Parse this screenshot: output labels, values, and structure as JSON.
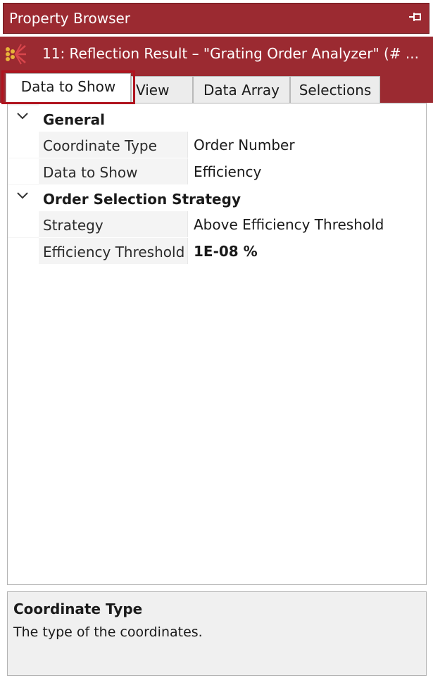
{
  "window": {
    "title": "Property Browser",
    "pin_icon": "pin-icon"
  },
  "context": {
    "icon": "grating-analyzer-icon",
    "text": "11: Reflection Result – \"Grating Order Analyzer\" (# ..."
  },
  "tabs": [
    {
      "label": "Data to Show",
      "active": true
    },
    {
      "label": "View",
      "active": false
    },
    {
      "label": "Data Array",
      "active": false
    },
    {
      "label": "Selections",
      "active": false
    }
  ],
  "grid": {
    "categories": [
      {
        "label": "General",
        "expanded": true,
        "properties": [
          {
            "name": "Coordinate Type",
            "value": "Order Number"
          },
          {
            "name": "Data to Show",
            "value": "Efficiency"
          }
        ]
      },
      {
        "label": "Order Selection Strategy",
        "expanded": true,
        "properties": [
          {
            "name": "Strategy",
            "value": "Above Efficiency Threshold"
          },
          {
            "name": "Efficiency Threshold",
            "value": "1E-08 %"
          }
        ]
      }
    ]
  },
  "description": {
    "title": "Coordinate Type",
    "text": "The type of the coordinates."
  },
  "colors": {
    "accent": "#9b2a31",
    "highlight_border": "#b0141f"
  }
}
